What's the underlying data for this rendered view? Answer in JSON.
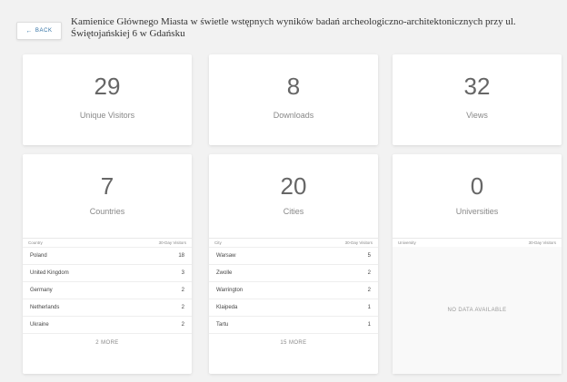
{
  "header": {
    "back_label": "BACK",
    "title": "Kamienice Głównego Miasta w świetle wstępnych wyników badań archeologiczno-architektonicznych przy ul. Świętojańskiej 6 w Gdańsku"
  },
  "metrics": [
    {
      "value": "29",
      "label": "Unique Visitors"
    },
    {
      "value": "8",
      "label": "Downloads"
    },
    {
      "value": "32",
      "label": "Views"
    }
  ],
  "countries": {
    "value": "7",
    "label": "Countries",
    "col1": "Country",
    "col2": "30-Day Visitors",
    "rows": [
      {
        "name": "Poland",
        "count": "18"
      },
      {
        "name": "United Kingdom",
        "count": "3"
      },
      {
        "name": "Germany",
        "count": "2"
      },
      {
        "name": "Netherlands",
        "count": "2"
      },
      {
        "name": "Ukraine",
        "count": "2"
      }
    ],
    "more": "2 MORE"
  },
  "cities": {
    "value": "20",
    "label": "Cities",
    "col1": "City",
    "col2": "30-Day Visitors",
    "rows": [
      {
        "name": "Warsaw",
        "count": "5"
      },
      {
        "name": "Zwolle",
        "count": "2"
      },
      {
        "name": "Warrington",
        "count": "2"
      },
      {
        "name": "Klaipeda",
        "count": "1"
      },
      {
        "name": "Tartu",
        "count": "1"
      }
    ],
    "more": "15 MORE"
  },
  "universities": {
    "value": "0",
    "label": "Universities",
    "col1": "University",
    "col2": "30-Day Visitors",
    "empty": "NO DATA AVAILABLE"
  }
}
